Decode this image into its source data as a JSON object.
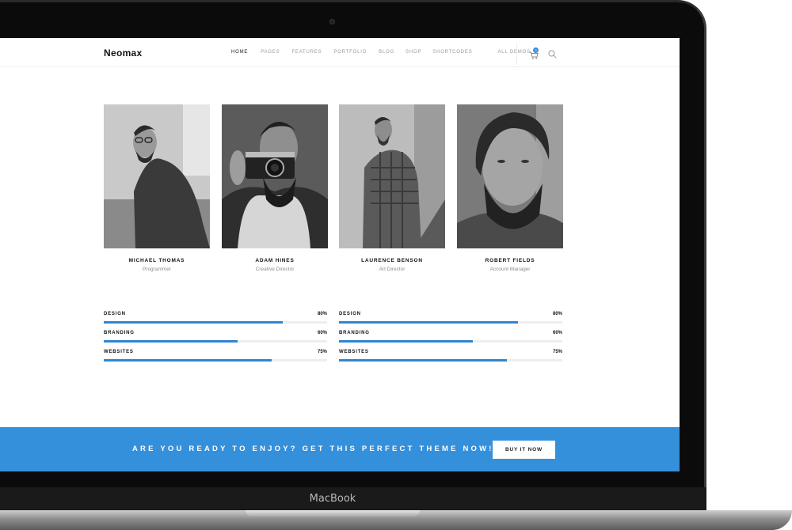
{
  "device": {
    "brand_label": "MacBook"
  },
  "header": {
    "logo": "Neomax",
    "nav": [
      {
        "label": "HOME",
        "active": true
      },
      {
        "label": "PAGES",
        "active": false
      },
      {
        "label": "FEATURES",
        "active": false
      },
      {
        "label": "PORTFOLIO",
        "active": false
      },
      {
        "label": "BLOG",
        "active": false
      },
      {
        "label": "SHOP",
        "active": false
      },
      {
        "label": "SHORTCODES",
        "active": false
      },
      {
        "label": "ALL DEMOS",
        "active": false
      }
    ],
    "cart_count": "0",
    "icons": {
      "cart": "cart-icon",
      "search": "search-icon"
    }
  },
  "team": [
    {
      "name": "MICHAEL THOMAS",
      "role": "Programmer"
    },
    {
      "name": "ADAM HINES",
      "role": "Creative Director"
    },
    {
      "name": "LAURENCE BENSON",
      "role": "Art Director"
    },
    {
      "name": "ROBERT FIELDS",
      "role": "Account Manager"
    }
  ],
  "skills": {
    "left": [
      {
        "label": "DESIGN",
        "value": "80%",
        "fraction": 0.8
      },
      {
        "label": "BRANDING",
        "value": "60%",
        "fraction": 0.6
      },
      {
        "label": "WEBSITES",
        "value": "75%",
        "fraction": 0.75
      }
    ],
    "right": [
      {
        "label": "DESIGN",
        "value": "80%",
        "fraction": 0.8
      },
      {
        "label": "BRANDING",
        "value": "60%",
        "fraction": 0.6
      },
      {
        "label": "WEBSITES",
        "value": "75%",
        "fraction": 0.75
      }
    ]
  },
  "cta": {
    "text": "ARE YOU READY TO ENJOY? GET THIS PERFECT THEME NOW!",
    "button": "BUY IT NOW"
  },
  "colors": {
    "accent": "#3590dc",
    "bar": "#2f86d3",
    "bezel": "#0b0b0b"
  }
}
